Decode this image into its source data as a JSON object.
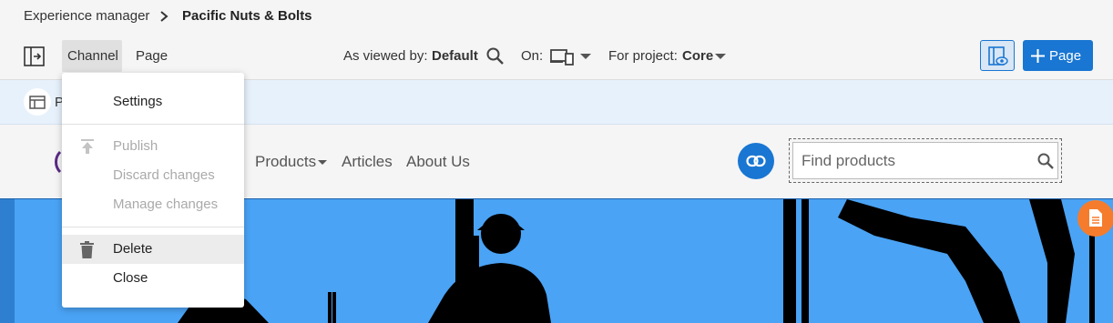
{
  "breadcrumb": {
    "root": "Experience manager",
    "current": "Pacific Nuts & Bolts"
  },
  "toolbar": {
    "channel_tab": "Channel",
    "page_tab": "Page",
    "viewed_by_label": "As viewed by:",
    "viewed_by_value": "Default",
    "on_label": "On:",
    "project_label": "For project:",
    "project_value": "Core",
    "add_page_label": "Page"
  },
  "infobar": {
    "label_partial": "P"
  },
  "site": {
    "nav": [
      "Products",
      "Articles",
      "About Us"
    ],
    "search_placeholder": "Find products"
  },
  "menu": {
    "items": [
      {
        "label": "Settings",
        "enabled": true
      },
      {
        "label": "Publish",
        "enabled": false
      },
      {
        "label": "Discard changes",
        "enabled": false
      },
      {
        "label": "Manage changes",
        "enabled": false
      },
      {
        "label": "Delete",
        "enabled": true
      },
      {
        "label": "Close",
        "enabled": true
      }
    ]
  },
  "colors": {
    "accent": "#1976d2",
    "hero": "#4aa3f5",
    "badge": "#f57c2c"
  }
}
